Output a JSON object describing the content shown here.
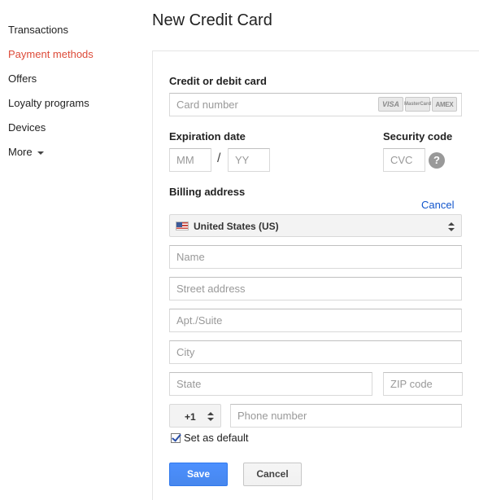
{
  "sidebar": {
    "items": [
      {
        "label": "Transactions"
      },
      {
        "label": "Payment methods",
        "active": true
      },
      {
        "label": "Offers"
      },
      {
        "label": "Loyalty programs"
      },
      {
        "label": "Devices"
      },
      {
        "label": "More"
      }
    ]
  },
  "page": {
    "title": "New Credit Card"
  },
  "form": {
    "card_label": "Credit or debit card",
    "card_placeholder": "Card number",
    "card_logos": [
      "VISA",
      "MasterCard",
      "AMEX"
    ],
    "expiration_label": "Expiration date",
    "month_placeholder": "MM",
    "separator": "/",
    "year_placeholder": "YY",
    "security_label": "Security code",
    "cvc_placeholder": "CVC",
    "help_glyph": "?",
    "billing_label": "Billing address",
    "cancel_link": "Cancel",
    "country_value": "United States (US)",
    "name_placeholder": "Name",
    "street_placeholder": "Street address",
    "apt_placeholder": "Apt./Suite",
    "city_placeholder": "City",
    "state_placeholder": "State",
    "zip_placeholder": "ZIP code",
    "phone_code": "+1",
    "phone_placeholder": "Phone number",
    "default_label": "Set as default",
    "default_checked": true,
    "save_label": "Save",
    "cancel_label": "Cancel"
  },
  "colors": {
    "active_nav": "#dd4b39",
    "link": "#1155cc",
    "primary_button": "#4d90fe"
  }
}
